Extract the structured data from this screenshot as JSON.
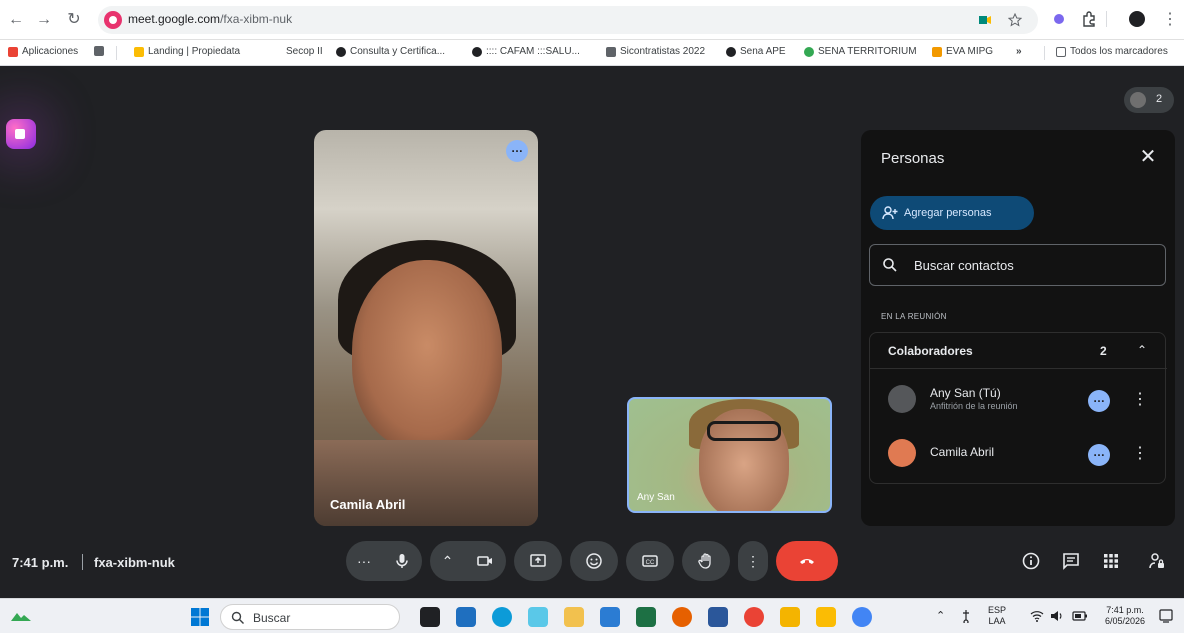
{
  "browser": {
    "url_host": "meet.google.com",
    "url_path": "/fxa-xibm-nuk"
  },
  "bookmarks": {
    "items": [
      {
        "label": "Aplicaciones"
      },
      {
        "label": "Landing | Propiedata"
      },
      {
        "label": "Secop II"
      },
      {
        "label": "Consulta y Certifica..."
      },
      {
        "label": ":::: CAFAM :::SALU..."
      },
      {
        "label": "Sicontratistas 2022"
      },
      {
        "label": "Sena APE"
      },
      {
        "label": "SENA TERRITORIUM"
      },
      {
        "label": "EVA MIPG"
      }
    ],
    "more": "»",
    "all_label": "Todos los marcadores"
  },
  "meeting": {
    "participant_count": "2",
    "main_tile_name": "Camila Abril",
    "self_tile_name": "Any San",
    "time": "7:41 p.m.",
    "code": "fxa-xibm-nuk"
  },
  "people_panel": {
    "title": "Personas",
    "add_label": "Agregar personas",
    "search_placeholder": "Buscar contactos",
    "section_label": "EN LA REUNIÓN",
    "group_title": "Colaboradores",
    "group_count": "2",
    "people": [
      {
        "name": "Any San (Tú)",
        "role": "Anfitrión de la reunión"
      },
      {
        "name": "Camila Abril",
        "role": ""
      }
    ]
  },
  "taskbar": {
    "search_label": "Buscar",
    "lang_top": "ESP",
    "lang_bottom": "LAA",
    "clock_time": "7:41 p.m.",
    "clock_date": "6/05/2026"
  },
  "colors": {
    "accent": "#8ab4f8",
    "end_call": "#ea4335",
    "panel_bg": "#121212",
    "stage_bg": "#202124"
  }
}
